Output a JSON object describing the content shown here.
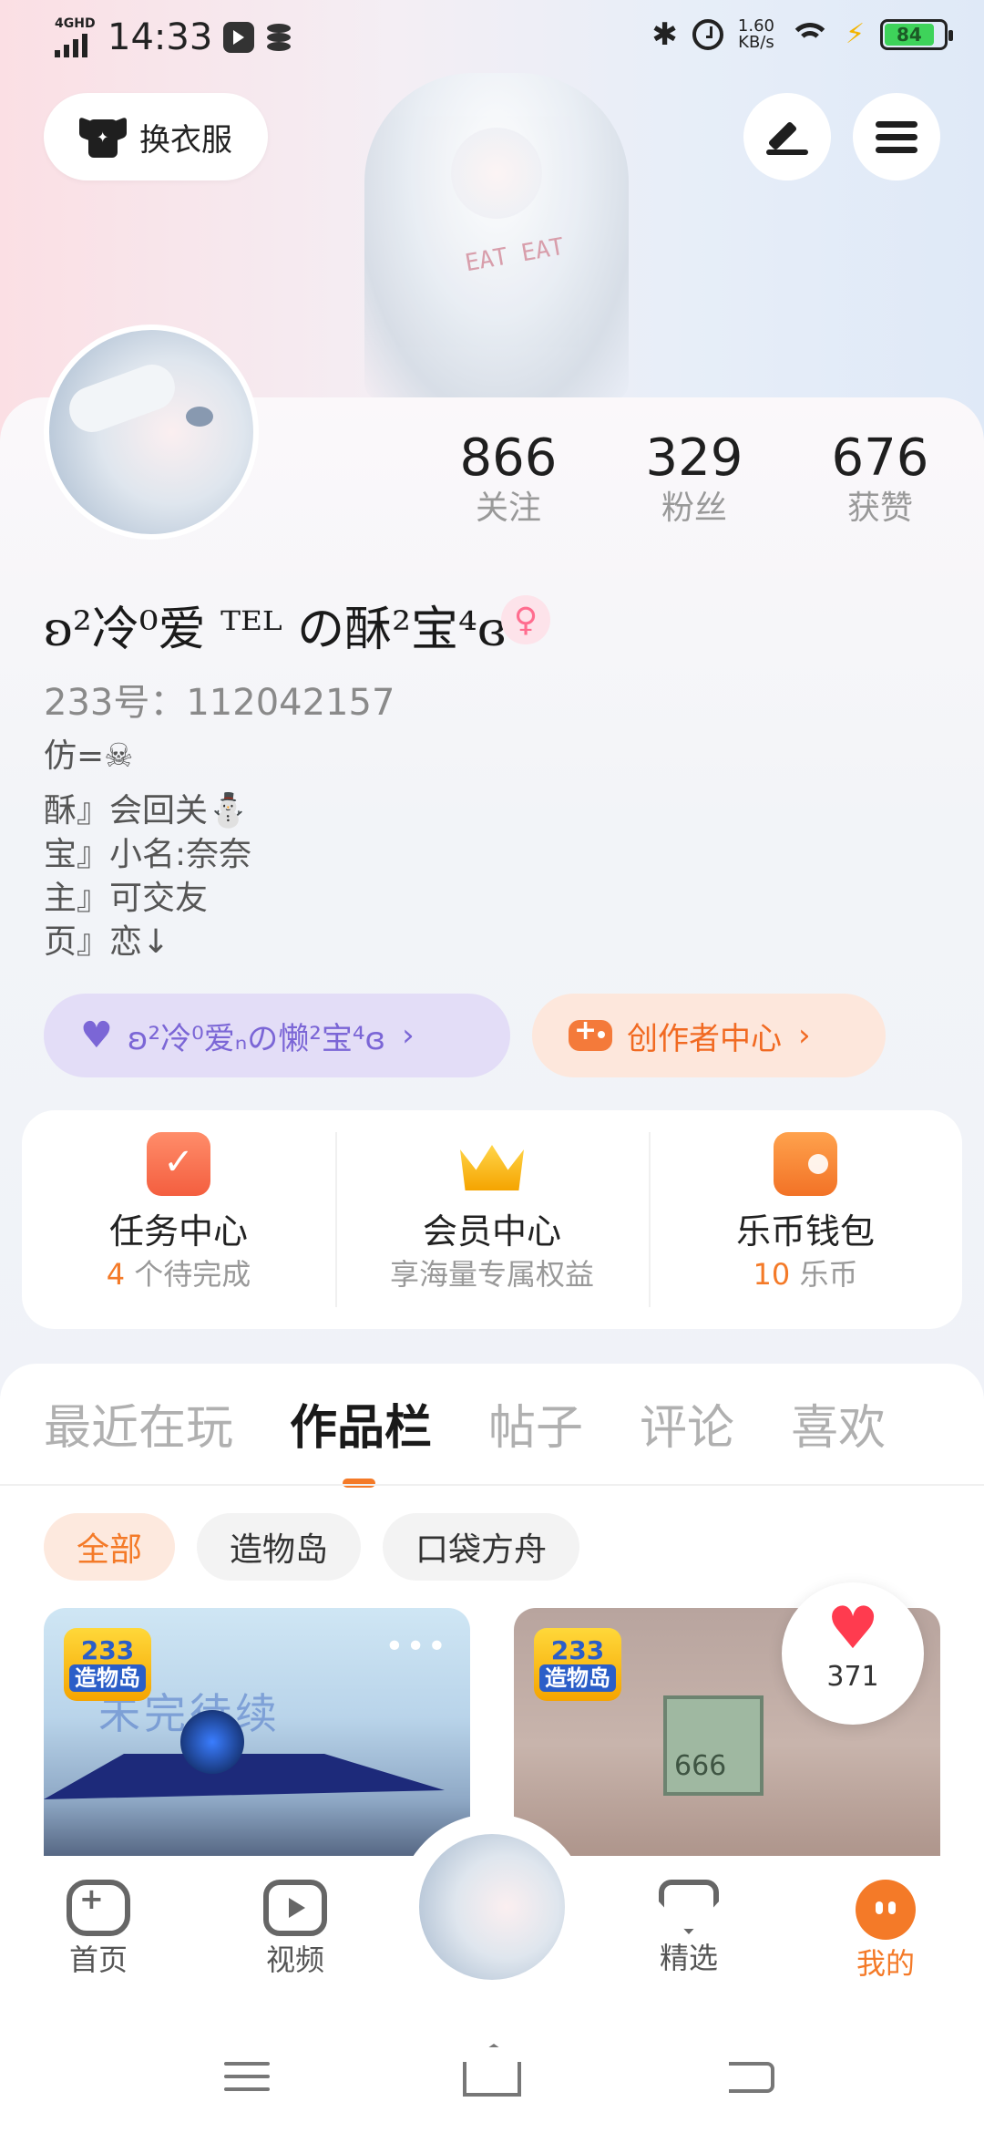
{
  "status_bar": {
    "network": "4GHD",
    "time": "14:33",
    "speed_value": "1.60",
    "speed_unit": "KB/s",
    "battery": "84"
  },
  "header": {
    "outfit_label": "换衣服",
    "edit_icon": "pen-icon",
    "menu_icon": "hamburger-icon",
    "banner_shirt_text": "EAT EAT"
  },
  "profile": {
    "stats": [
      {
        "value": "866",
        "label": "关注"
      },
      {
        "value": "329",
        "label": "粉丝"
      },
      {
        "value": "676",
        "label": "获赞"
      }
    ],
    "nickname": "ʚ²冷⁰爱 ᵀᴱᴸ の酥²宝⁴ɞ",
    "gender_icon": "female-icon",
    "uid": "233号：112042157",
    "bio": [
      "仿=☠",
      "酥』会回关⛄",
      "宝』小名:奈奈",
      "主』可交友",
      "页』恋↓"
    ],
    "fan_pill": "ʚ²冷⁰爱ₙの懒²宝⁴ɞ",
    "creator_pill": "创作者中心"
  },
  "quick_panel": [
    {
      "title": "任务中心",
      "sub_num": "4",
      "sub_text": " 个待完成",
      "icon": "calendar-check-icon"
    },
    {
      "title": "会员中心",
      "sub_num": "",
      "sub_text": "享海量专属权益",
      "icon": "crown-icon"
    },
    {
      "title": "乐币钱包",
      "sub_num": "10",
      "sub_text": " 乐币",
      "icon": "wallet-icon"
    }
  ],
  "tabs": [
    "最近在玩",
    "作品栏",
    "帖子",
    "评论",
    "喜欢"
  ],
  "active_tab": "作品栏",
  "chips": [
    "全部",
    "造物岛",
    "口袋方舟"
  ],
  "cards": [
    {
      "badge_top": "233",
      "badge_bottom": "造物岛",
      "art_text": "未完待续",
      "more": "•••"
    },
    {
      "badge_top": "233",
      "badge_bottom": "造物岛",
      "sign_text": "666"
    }
  ],
  "like_count": "371",
  "bottom_nav": [
    {
      "label": "首页",
      "icon": "gamepad-icon"
    },
    {
      "label": "视频",
      "icon": "video-play-icon"
    },
    {
      "label": "精选",
      "icon": "gem-heart-icon"
    },
    {
      "label": "我的",
      "icon": "me-icon"
    }
  ],
  "colors": {
    "accent": "#f47a28",
    "fan_purple": "#7b66d6",
    "like_red": "#ff3b4f"
  }
}
